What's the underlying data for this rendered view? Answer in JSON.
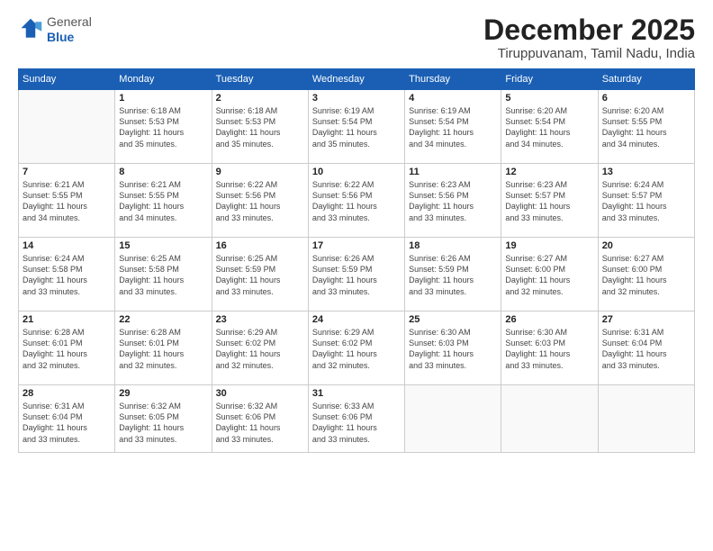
{
  "header": {
    "logo_general": "General",
    "logo_blue": "Blue",
    "month_title": "December 2025",
    "location": "Tiruppuvanam, Tamil Nadu, India"
  },
  "weekdays": [
    "Sunday",
    "Monday",
    "Tuesday",
    "Wednesday",
    "Thursday",
    "Friday",
    "Saturday"
  ],
  "weeks": [
    [
      {
        "day": "",
        "info": ""
      },
      {
        "day": "1",
        "info": "Sunrise: 6:18 AM\nSunset: 5:53 PM\nDaylight: 11 hours\nand 35 minutes."
      },
      {
        "day": "2",
        "info": "Sunrise: 6:18 AM\nSunset: 5:53 PM\nDaylight: 11 hours\nand 35 minutes."
      },
      {
        "day": "3",
        "info": "Sunrise: 6:19 AM\nSunset: 5:54 PM\nDaylight: 11 hours\nand 35 minutes."
      },
      {
        "day": "4",
        "info": "Sunrise: 6:19 AM\nSunset: 5:54 PM\nDaylight: 11 hours\nand 34 minutes."
      },
      {
        "day": "5",
        "info": "Sunrise: 6:20 AM\nSunset: 5:54 PM\nDaylight: 11 hours\nand 34 minutes."
      },
      {
        "day": "6",
        "info": "Sunrise: 6:20 AM\nSunset: 5:55 PM\nDaylight: 11 hours\nand 34 minutes."
      }
    ],
    [
      {
        "day": "7",
        "info": "Sunrise: 6:21 AM\nSunset: 5:55 PM\nDaylight: 11 hours\nand 34 minutes."
      },
      {
        "day": "8",
        "info": "Sunrise: 6:21 AM\nSunset: 5:55 PM\nDaylight: 11 hours\nand 34 minutes."
      },
      {
        "day": "9",
        "info": "Sunrise: 6:22 AM\nSunset: 5:56 PM\nDaylight: 11 hours\nand 33 minutes."
      },
      {
        "day": "10",
        "info": "Sunrise: 6:22 AM\nSunset: 5:56 PM\nDaylight: 11 hours\nand 33 minutes."
      },
      {
        "day": "11",
        "info": "Sunrise: 6:23 AM\nSunset: 5:56 PM\nDaylight: 11 hours\nand 33 minutes."
      },
      {
        "day": "12",
        "info": "Sunrise: 6:23 AM\nSunset: 5:57 PM\nDaylight: 11 hours\nand 33 minutes."
      },
      {
        "day": "13",
        "info": "Sunrise: 6:24 AM\nSunset: 5:57 PM\nDaylight: 11 hours\nand 33 minutes."
      }
    ],
    [
      {
        "day": "14",
        "info": "Sunrise: 6:24 AM\nSunset: 5:58 PM\nDaylight: 11 hours\nand 33 minutes."
      },
      {
        "day": "15",
        "info": "Sunrise: 6:25 AM\nSunset: 5:58 PM\nDaylight: 11 hours\nand 33 minutes."
      },
      {
        "day": "16",
        "info": "Sunrise: 6:25 AM\nSunset: 5:59 PM\nDaylight: 11 hours\nand 33 minutes."
      },
      {
        "day": "17",
        "info": "Sunrise: 6:26 AM\nSunset: 5:59 PM\nDaylight: 11 hours\nand 33 minutes."
      },
      {
        "day": "18",
        "info": "Sunrise: 6:26 AM\nSunset: 5:59 PM\nDaylight: 11 hours\nand 33 minutes."
      },
      {
        "day": "19",
        "info": "Sunrise: 6:27 AM\nSunset: 6:00 PM\nDaylight: 11 hours\nand 32 minutes."
      },
      {
        "day": "20",
        "info": "Sunrise: 6:27 AM\nSunset: 6:00 PM\nDaylight: 11 hours\nand 32 minutes."
      }
    ],
    [
      {
        "day": "21",
        "info": "Sunrise: 6:28 AM\nSunset: 6:01 PM\nDaylight: 11 hours\nand 32 minutes."
      },
      {
        "day": "22",
        "info": "Sunrise: 6:28 AM\nSunset: 6:01 PM\nDaylight: 11 hours\nand 32 minutes."
      },
      {
        "day": "23",
        "info": "Sunrise: 6:29 AM\nSunset: 6:02 PM\nDaylight: 11 hours\nand 32 minutes."
      },
      {
        "day": "24",
        "info": "Sunrise: 6:29 AM\nSunset: 6:02 PM\nDaylight: 11 hours\nand 32 minutes."
      },
      {
        "day": "25",
        "info": "Sunrise: 6:30 AM\nSunset: 6:03 PM\nDaylight: 11 hours\nand 33 minutes."
      },
      {
        "day": "26",
        "info": "Sunrise: 6:30 AM\nSunset: 6:03 PM\nDaylight: 11 hours\nand 33 minutes."
      },
      {
        "day": "27",
        "info": "Sunrise: 6:31 AM\nSunset: 6:04 PM\nDaylight: 11 hours\nand 33 minutes."
      }
    ],
    [
      {
        "day": "28",
        "info": "Sunrise: 6:31 AM\nSunset: 6:04 PM\nDaylight: 11 hours\nand 33 minutes."
      },
      {
        "day": "29",
        "info": "Sunrise: 6:32 AM\nSunset: 6:05 PM\nDaylight: 11 hours\nand 33 minutes."
      },
      {
        "day": "30",
        "info": "Sunrise: 6:32 AM\nSunset: 6:06 PM\nDaylight: 11 hours\nand 33 minutes."
      },
      {
        "day": "31",
        "info": "Sunrise: 6:33 AM\nSunset: 6:06 PM\nDaylight: 11 hours\nand 33 minutes."
      },
      {
        "day": "",
        "info": ""
      },
      {
        "day": "",
        "info": ""
      },
      {
        "day": "",
        "info": ""
      }
    ]
  ]
}
